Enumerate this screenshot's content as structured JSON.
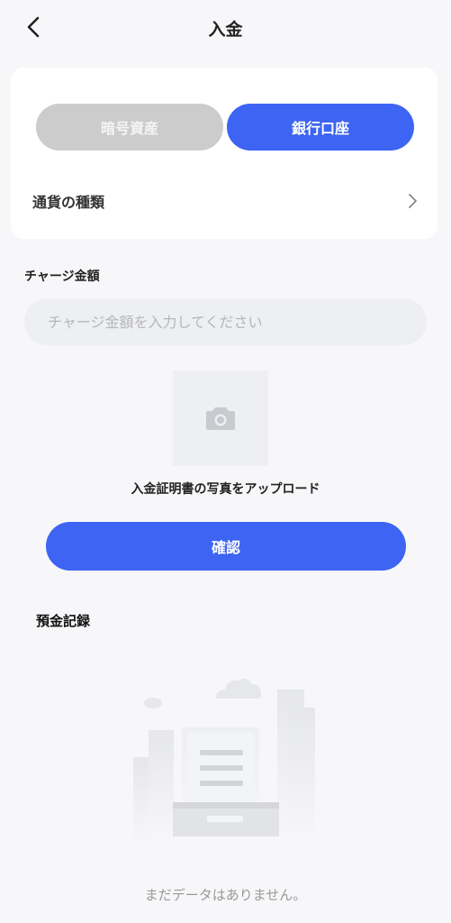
{
  "header": {
    "title": "入金",
    "back_icon": "chevron-left-icon"
  },
  "tabs": [
    {
      "label": "暗号資産",
      "active": false
    },
    {
      "label": "銀行口座",
      "active": true
    }
  ],
  "currency": {
    "label": "通貨の種類",
    "icon": "chevron-right-icon"
  },
  "amount": {
    "label": "チャージ金額",
    "placeholder": "チャージ金額を入力してください",
    "value": ""
  },
  "upload": {
    "icon": "camera-icon",
    "label": "入金証明書の写真をアップロード"
  },
  "confirm_label": "確認",
  "records": {
    "title": "預金記録",
    "empty_text": "まだデータはありません。"
  },
  "colors": {
    "accent": "#3d64f2",
    "inactive_tab": "#cccccc",
    "page_bg": "#f7f7f9",
    "input_bg": "#eeeff1"
  }
}
